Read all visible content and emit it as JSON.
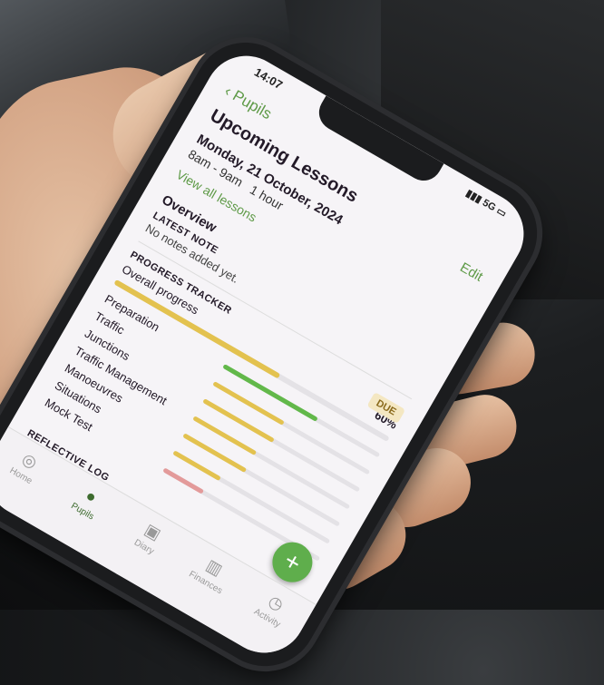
{
  "status_bar": {
    "time": "14:07",
    "network": "5G",
    "battery_icon": "battery-icon"
  },
  "nav": {
    "back_label": "Pupils",
    "edit_label": "Edit"
  },
  "lessons": {
    "heading": "Upcoming Lessons",
    "date": "Monday, 21 October, 2024",
    "time_range": "8am - 9am",
    "duration": "1 hour",
    "view_all": "View all lessons"
  },
  "overview": {
    "title": "Overview",
    "latest_note_label": "LATEST NOTE",
    "latest_note_text": "No notes added yet.",
    "due_badge": "DUE"
  },
  "tracker": {
    "label": "PROGRESS TRACKER",
    "overall_label": "Overall progress",
    "overall_value": "60%",
    "overall_fraction": 0.6,
    "overall_color": "#e3c24f",
    "items": [
      {
        "name": "Preparation",
        "fraction": 0.6,
        "color": "#62b84a"
      },
      {
        "name": "Traffic",
        "fraction": 0.45,
        "color": "#e3c24f"
      },
      {
        "name": "Junctions",
        "fraction": 0.45,
        "color": "#e3c24f"
      },
      {
        "name": "Traffic Management",
        "fraction": 0.4,
        "color": "#e3c24f"
      },
      {
        "name": "Manoeuvres",
        "fraction": 0.4,
        "color": "#e3c24f"
      },
      {
        "name": "Situations",
        "fraction": 0.3,
        "color": "#e3c24f"
      },
      {
        "name": "Mock Test",
        "fraction": 0.25,
        "color": "#e39a9a"
      }
    ]
  },
  "reflective_log": {
    "label": "REFLECTIVE LOG"
  },
  "tabs": [
    {
      "label": "Home",
      "icon": "steering-wheel-icon"
    },
    {
      "label": "Pupils",
      "icon": "person-icon"
    },
    {
      "label": "Diary",
      "icon": "calendar-icon"
    },
    {
      "label": "Finances",
      "icon": "bar-chart-icon"
    },
    {
      "label": "Activity",
      "icon": "activity-icon"
    }
  ],
  "fab": {
    "label": "+"
  }
}
